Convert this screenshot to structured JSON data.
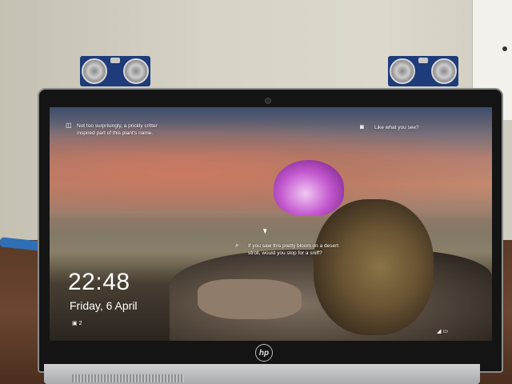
{
  "lock_screen": {
    "caption_top_left": "Not too surprisingly, a prickly critter inspired part of this plant's name.",
    "caption_top_right": "Like what you see?",
    "caption_center": "If you saw this pretty bloom on a desert stroll, would you stop for a sniff?",
    "time": "22:48",
    "date": "Friday, 6 April",
    "notification_count": "2"
  },
  "laptop": {
    "brand": "hp"
  },
  "icons": {
    "top_left": "camera-outline-icon",
    "top_right": "camera-icon",
    "center": "search-icon",
    "status_left": "notification-icon",
    "status_right": "wifi-battery-icon"
  }
}
